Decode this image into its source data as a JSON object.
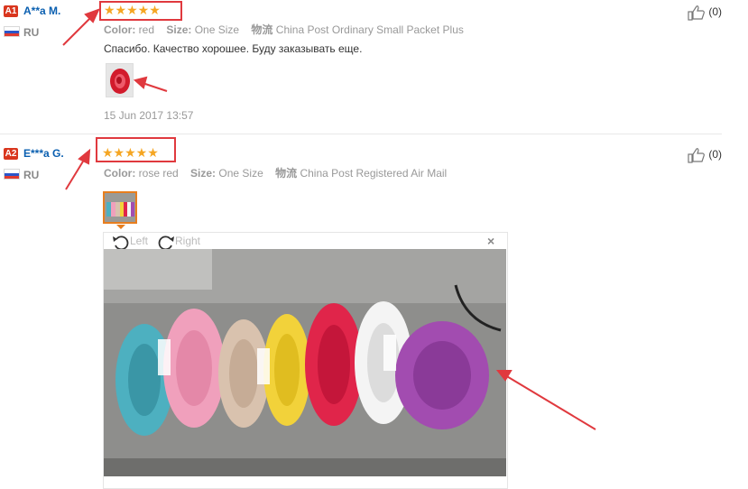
{
  "reviews": [
    {
      "level": "A1",
      "name": "A**a M.",
      "country": "RU",
      "rating": "★★★★★",
      "color_label": "Color:",
      "color_value": "red",
      "size_label": "Size:",
      "size_value": "One Size",
      "shipping_label": "物流",
      "shipping_value": "China Post Ordinary Small Packet Plus",
      "feedback": "Спасибо. Качество хорошее. Буду заказывать еще.",
      "date": "15 Jun 2017 13:57",
      "helpful_count": "(0)"
    },
    {
      "level": "A2",
      "name": "E***a G.",
      "country": "RU",
      "rating": "★★★★★",
      "color_label": "Color:",
      "color_value": "rose red",
      "size_label": "Size:",
      "size_value": "One Size",
      "shipping_label": "物流",
      "shipping_value": "China Post Registered Air Mail",
      "helpful_count": "(0)"
    }
  ],
  "viewer": {
    "rotate_left": "Left",
    "rotate_right": "Right",
    "close": "×"
  },
  "colors": {
    "star": "#f5a623",
    "annotation_red": "#e0393e",
    "username_blue": "#0a5fb0",
    "level_badge": "#d9361e",
    "hair_ties": [
      "#4db0c0",
      "#f0a0bc",
      "#d9c2ae",
      "#f2d23a",
      "#e0254a",
      "#f4f4f4",
      "#a24cb0"
    ]
  },
  "icons": [
    "thumbs-up-icon",
    "rotate-left-icon",
    "rotate-right-icon",
    "close-icon",
    "flag-icon"
  ]
}
